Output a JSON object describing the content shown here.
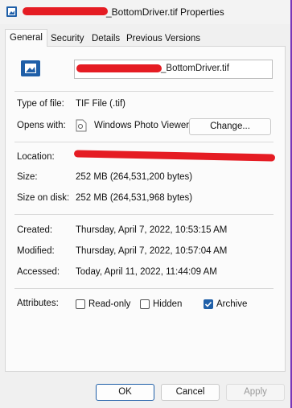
{
  "window": {
    "title_suffix": "_BottomDriver.tif Properties"
  },
  "tabs": [
    {
      "label": "General"
    },
    {
      "label": "Security"
    },
    {
      "label": "Details"
    },
    {
      "label": "Previous Versions"
    }
  ],
  "file": {
    "name_suffix": "_BottomDriver.tif"
  },
  "rows": {
    "type_label": "Type of file:",
    "type_value": "TIF File (.tif)",
    "opens_label": "Opens with:",
    "opens_value": "Windows Photo Viewer",
    "change_button": "Change...",
    "location_label": "Location:",
    "size_label": "Size:",
    "size_value": "252 MB (264,531,200 bytes)",
    "size_disk_label": "Size on disk:",
    "size_disk_value": "252 MB (264,531,968 bytes)",
    "created_label": "Created:",
    "created_value": "Thursday, April 7, 2022, 10:53:15 AM",
    "modified_label": "Modified:",
    "modified_value": "Thursday, April 7, 2022, 10:57:04 AM",
    "accessed_label": "Accessed:",
    "accessed_value": "Today, April 11, 2022, 11:44:09 AM",
    "attributes_label": "Attributes:"
  },
  "attributes": {
    "readonly": {
      "label": "Read-only",
      "checked": false
    },
    "hidden": {
      "label": "Hidden",
      "checked": false
    },
    "archive": {
      "label": "Archive",
      "checked": true
    }
  },
  "buttons": {
    "ok": "OK",
    "cancel": "Cancel",
    "apply": "Apply"
  },
  "colors": {
    "accent": "#1f5fa8",
    "redaction": "#e51c23",
    "desktop": "#6a2da0"
  }
}
